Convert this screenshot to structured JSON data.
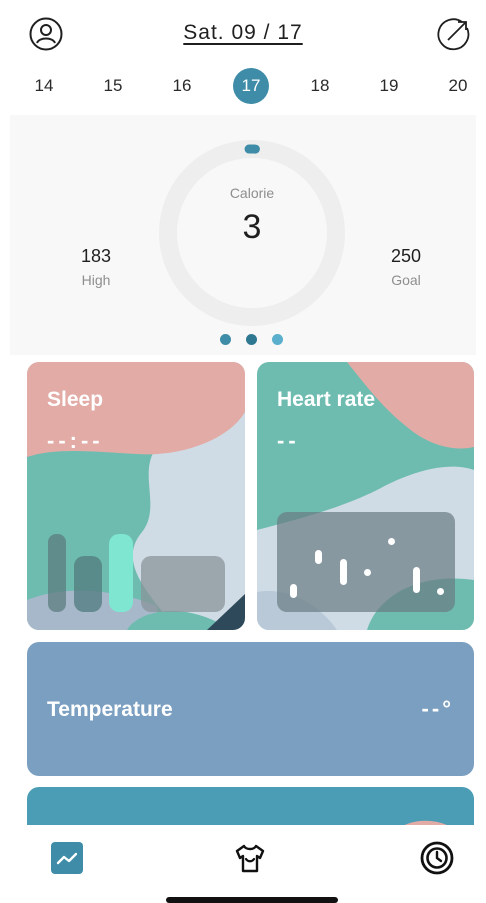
{
  "header": {
    "date_title": "Sat. 09 / 17",
    "left_icon": "user-profile-icon",
    "right_icon": "share-out-icon"
  },
  "week": {
    "days": [
      "14",
      "15",
      "16",
      "17",
      "18",
      "19",
      "20"
    ],
    "selected": "17"
  },
  "summary": {
    "calorie_label": "Calorie",
    "calorie_value": "3",
    "high_value": "183",
    "high_label": "High",
    "goal_value": "250",
    "goal_label": "Goal",
    "progress": 0.012
  },
  "cards": {
    "sleep": {
      "title": "Sleep",
      "value": "--:--"
    },
    "heart": {
      "title": "Heart rate",
      "value": "--"
    },
    "temperature": {
      "title": "Temperature",
      "value": "--°"
    }
  },
  "tabbar": {
    "tabs": [
      "activity-chart-icon",
      "shirt-device-icon",
      "clock-icon"
    ]
  },
  "colors": {
    "accent": "#3e8ca7",
    "coral": "#e2aba6",
    "teal": "#6ebcb0",
    "slate": "#cfdce6",
    "temp": "#7b9fc1",
    "ring": "#eeeeee"
  }
}
